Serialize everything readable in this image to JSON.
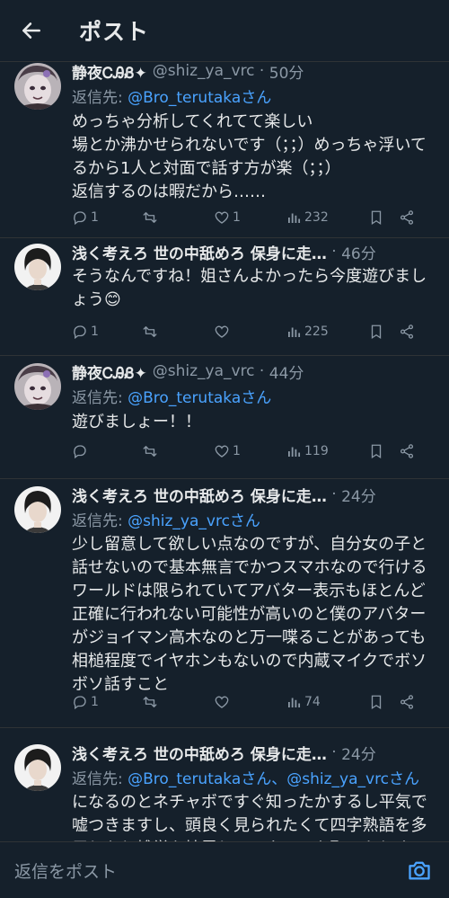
{
  "header": {
    "title": "ポスト"
  },
  "posts": [
    {
      "name": "静夜ᏟᎯᏰ✦",
      "handle": "@shiz_ya_vrc",
      "time": "50分",
      "reply_prefix": "返信先: ",
      "reply_mention": "@Bro_terutakaさん",
      "text": "めっちゃ分析してくれてて楽しい\n場とか沸かせられないです（；；）めっちゃ浮いてるから1人と対面で話す方が楽（；；）\n返信するのは暇だから……",
      "replies": "1",
      "retweets": "",
      "likes": "1",
      "views": "232"
    },
    {
      "name": "浅く考えろ 世の中舐めろ 保身に走…",
      "handle": "",
      "time": "46分",
      "reply_prefix": "",
      "reply_mention": "",
      "text": "そうなんですね！姐さんよかったら今度遊びましょう😊",
      "replies": "1",
      "retweets": "",
      "likes": "",
      "views": "225"
    },
    {
      "name": "静夜ᏟᎯᏰ✦",
      "handle": "@shiz_ya_vrc",
      "time": "44分",
      "reply_prefix": "返信先: ",
      "reply_mention": "@Bro_terutakaさん",
      "text": "遊びましょー！！",
      "replies": "",
      "retweets": "",
      "likes": "1",
      "views": "119"
    },
    {
      "name": "浅く考えろ 世の中舐めろ 保身に走…",
      "handle": "",
      "time": "24分",
      "reply_prefix": "返信先: ",
      "reply_mention": "@shiz_ya_vrcさん",
      "text": "少し留意して欲しい点なのですが、自分女の子と話せないので基本無言でかつスマホなので行けるワールドは限られていてアバター表示もほとんど正確に行われない可能性が高いのと僕のアバターがジョイマン高木なのと万一喋ることがあっても相槌程度でイヤホンもないので内蔵マイクでボソボソ話すこと",
      "replies": "1",
      "retweets": "",
      "likes": "",
      "views": "74"
    },
    {
      "name": "浅く考えろ 世の中舐めろ 保身に走…",
      "handle": "",
      "time": "24分",
      "reply_prefix": "返信先: ",
      "reply_mention": "@Bro_terutakaさん、@shiz_ya_vrcさん",
      "text": "になるのとネチャボですぐ知ったかするし平気で嘘つきますし、頭良く見られたくて四字熟語を多用したり雑学を披露してマウントを取ったりする",
      "replies": "",
      "retweets": "",
      "likes": "",
      "views": ""
    }
  ],
  "reply_bar": {
    "placeholder": "返信をポスト"
  },
  "colors": {
    "background": "#15202b",
    "text": "#e7e9ea",
    "muted": "#8b98a5",
    "link": "#4aa3ff",
    "divider": "#2f3336"
  },
  "icons": [
    "back-arrow-icon",
    "reply-icon",
    "retweet-icon",
    "like-icon",
    "views-icon",
    "bookmark-icon",
    "share-icon",
    "camera-icon"
  ]
}
